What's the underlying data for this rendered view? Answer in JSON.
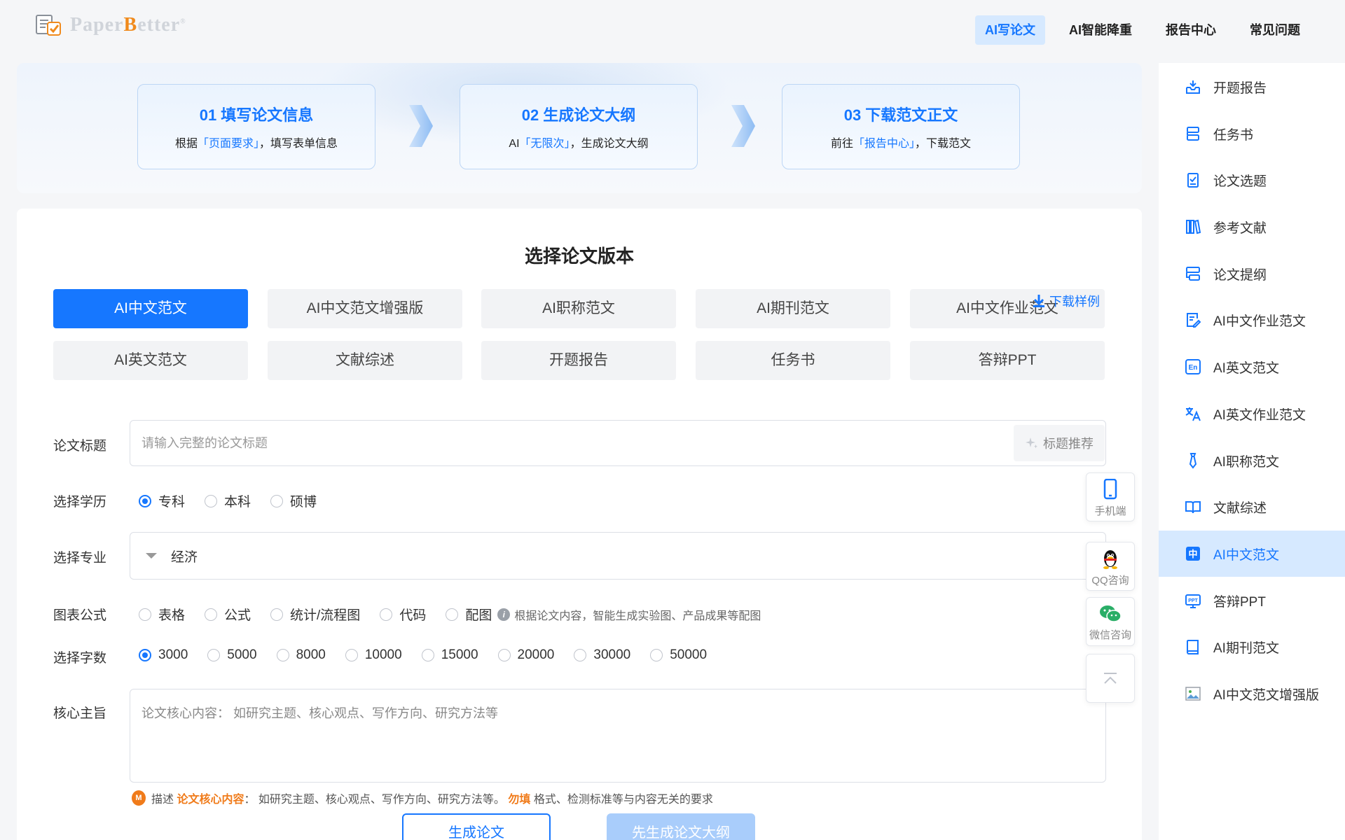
{
  "brand": {
    "name_part1": "Paper",
    "name_part2": "B",
    "name_part3": "etter",
    "reg": "®"
  },
  "nav": [
    {
      "label": "AI写论文",
      "active": true
    },
    {
      "label": "AI智能降重",
      "active": false
    },
    {
      "label": "报告中心",
      "active": false
    },
    {
      "label": "常见问题",
      "active": false
    }
  ],
  "steps": [
    {
      "title": "01  填写论文信息",
      "desc_pre": "根据",
      "desc_hl": "「页面要求」",
      "desc_post": "，填写表单信息"
    },
    {
      "title": "02  生成论文大纲",
      "desc_pre": "AI",
      "desc_hl": "「无限次」",
      "desc_post": "，生成论文大纲"
    },
    {
      "title": "03  下载范文正文",
      "desc_pre": "前往",
      "desc_hl": "「报告中心」",
      "desc_post": "，下载范文"
    }
  ],
  "main": {
    "section_title": "选择论文版本",
    "download_sample": "下载样例",
    "versions": [
      {
        "label": "AI中文范文",
        "active": true
      },
      {
        "label": "AI中文范文增强版",
        "active": false
      },
      {
        "label": "AI职称范文",
        "active": false
      },
      {
        "label": "AI期刊范文",
        "active": false
      },
      {
        "label": "AI中文作业范文",
        "active": false
      },
      {
        "label": "AI英文范文",
        "active": false
      },
      {
        "label": "文献综述",
        "active": false
      },
      {
        "label": "开题报告",
        "active": false
      },
      {
        "label": "任务书",
        "active": false
      },
      {
        "label": "答辩PPT",
        "active": false
      }
    ]
  },
  "form": {
    "title_label": "论文标题",
    "title_placeholder": "请输入完整的论文标题",
    "title_suggest": "标题推荐",
    "education_label": "选择学历",
    "education_options": [
      {
        "label": "专科",
        "checked": true
      },
      {
        "label": "本科",
        "checked": false
      },
      {
        "label": "硕博",
        "checked": false
      }
    ],
    "major_label": "选择专业",
    "major_value": "经济",
    "chart_label": "图表公式",
    "chart_options": [
      {
        "label": "表格",
        "checked": false
      },
      {
        "label": "公式",
        "checked": false
      },
      {
        "label": "统计/流程图",
        "checked": false
      },
      {
        "label": "代码",
        "checked": false
      },
      {
        "label": "配图",
        "checked": false
      }
    ],
    "chart_hint": "根据论文内容，智能生成实验图、产品成果等配图",
    "words_label": "选择字数",
    "word_options": [
      {
        "label": "3000",
        "checked": true
      },
      {
        "label": "5000",
        "checked": false
      },
      {
        "label": "8000",
        "checked": false
      },
      {
        "label": "10000",
        "checked": false
      },
      {
        "label": "15000",
        "checked": false
      },
      {
        "label": "20000",
        "checked": false
      },
      {
        "label": "30000",
        "checked": false
      },
      {
        "label": "50000",
        "checked": false
      }
    ],
    "core_label": "核心主旨",
    "core_placeholder": "论文核心内容： 如研究主题、核心观点、写作方向、研究方法等",
    "core_hint_1": "描述",
    "core_hint_2": "论文核心内容",
    "core_hint_3": "： 如研究主题、核心观点、写作方向、研究方法等。",
    "core_hint_4": "勿填",
    "core_hint_5": "格式、检测标准等与内容无关的要求",
    "btn_generate": "生成论文",
    "btn_outline": "先生成论文大纲"
  },
  "float_tools": [
    {
      "label": "手机端",
      "icon": "phone-icon"
    },
    {
      "label": "QQ咨询",
      "icon": "qq-icon"
    },
    {
      "label": "微信咨询",
      "icon": "wechat-icon"
    },
    {
      "label": "",
      "icon": "back-to-top-icon"
    }
  ],
  "sidebar": {
    "items": [
      {
        "label": "开题报告",
        "icon": "inbox-icon",
        "active": false
      },
      {
        "label": "任务书",
        "icon": "task-icon",
        "active": false
      },
      {
        "label": "论文选题",
        "icon": "checklist-icon",
        "active": false
      },
      {
        "label": "参考文献",
        "icon": "books-icon",
        "active": false
      },
      {
        "label": "论文提纲",
        "icon": "outline-icon",
        "active": false
      },
      {
        "label": "AI中文作业范文",
        "icon": "edit-doc-icon",
        "active": false
      },
      {
        "label": "AI英文范文",
        "icon": "en-icon",
        "active": false
      },
      {
        "label": "AI英文作业范文",
        "icon": "translate-icon",
        "active": false
      },
      {
        "label": "AI职称范文",
        "icon": "tie-icon",
        "active": false
      },
      {
        "label": "文献综述",
        "icon": "open-book-icon",
        "active": false
      },
      {
        "label": "AI中文范文",
        "icon": "zhong-icon",
        "active": true
      },
      {
        "label": "答辩PPT",
        "icon": "ppt-icon",
        "active": false
      },
      {
        "label": "AI期刊范文",
        "icon": "journal-icon",
        "active": false
      },
      {
        "label": "AI中文范文增强版",
        "icon": "broken-image-icon",
        "active": false
      }
    ]
  },
  "colors": {
    "accent": "#1677ff",
    "accent_light": "#d6e9ff",
    "orange": "#f07b1a"
  }
}
